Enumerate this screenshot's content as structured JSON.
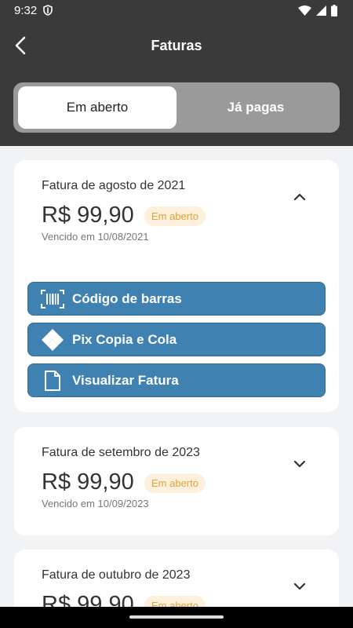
{
  "status": {
    "time": "9:32"
  },
  "header": {
    "title": "Faturas",
    "back_icon": "chevron-left-icon"
  },
  "tabs": [
    {
      "label": "Em aberto",
      "active": true
    },
    {
      "label": "Já pagas",
      "active": false
    }
  ],
  "invoices": [
    {
      "title": "Fatura de agosto de 2021",
      "amount": "R$ 99,90",
      "status": "Em aberto",
      "due": "Vencido em 10/08/2021",
      "expanded": true,
      "actions": [
        {
          "label": "Código de barras",
          "icon": "barcode-icon"
        },
        {
          "label": "Pix Copia e Cola",
          "icon": "pix-icon"
        },
        {
          "label": "Visualizar Fatura",
          "icon": "document-icon"
        }
      ]
    },
    {
      "title": "Fatura de setembro de 2023",
      "amount": "R$ 99,90",
      "status": "Em aberto",
      "due": "Vencido em 10/09/2023",
      "expanded": false
    },
    {
      "title": "Fatura de outubro de 2023",
      "amount": "R$ 99,90",
      "status": "Em aberto",
      "expanded": false
    }
  ],
  "colors": {
    "header_bg": "#3a3a3a",
    "action_button": "#3f81b1",
    "badge_text": "#e3a23c",
    "badge_bg": "#fdf0dc"
  }
}
